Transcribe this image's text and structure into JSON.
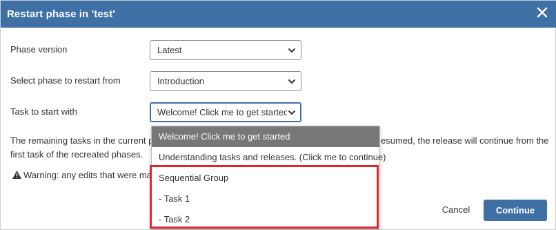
{
  "dialog": {
    "title": "Restart phase in 'test'",
    "close_icon": "close-icon"
  },
  "form": {
    "phase_version": {
      "label": "Phase version",
      "value": "Latest"
    },
    "restart_from": {
      "label": "Select phase to restart from",
      "value": "Introduction"
    },
    "start_task": {
      "label": "Task to start with",
      "value": "Welcome! Click me to get started"
    }
  },
  "info": {
    "line1_left": "The remaining tasks in the current p",
    "line1_right": "esumed, the release will continue from the",
    "line2": "first task of the recreated phases."
  },
  "warning": {
    "icon": "warning-icon",
    "text": "Warning: any edits that were mad"
  },
  "dropdown": {
    "options": [
      {
        "label": "Welcome! Click me to get started",
        "selected": true
      },
      {
        "label": "Understanding tasks and releases. (Click me to continue)",
        "selected": false
      },
      {
        "label": "Sequential Group",
        "selected": false
      },
      {
        "label": "- Task 1",
        "selected": false
      },
      {
        "label": "- Task 2",
        "selected": false
      }
    ]
  },
  "buttons": {
    "cancel": "Cancel",
    "continue": "Continue"
  },
  "colors": {
    "header": "#3e6fa5",
    "primary_button": "#3e6fa5",
    "selected_option": "#777777",
    "highlight": "#e2252c"
  }
}
